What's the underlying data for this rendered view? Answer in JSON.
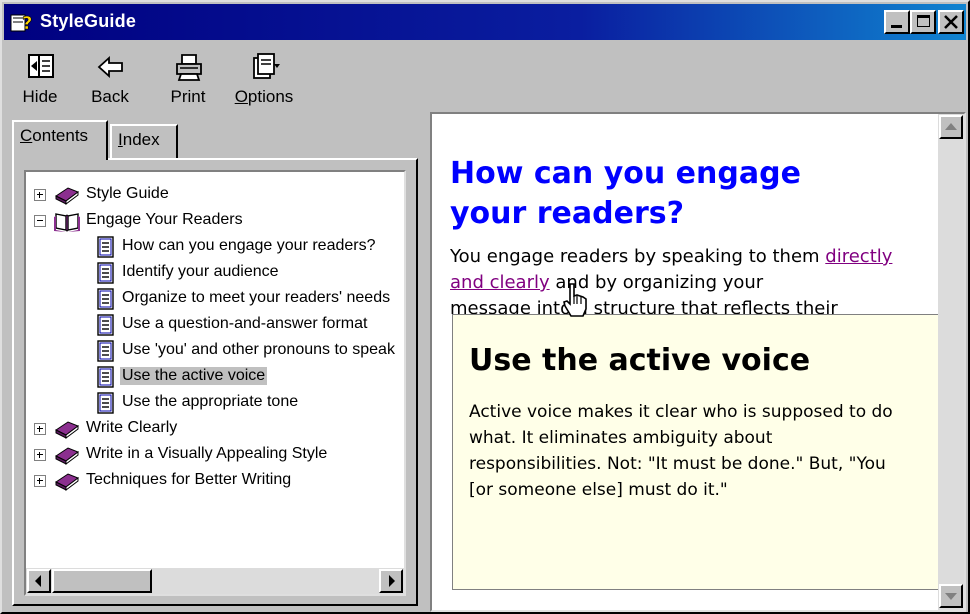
{
  "window": {
    "title": "StyleGuide"
  },
  "toolbar": {
    "hide": {
      "label": "Hide",
      "icon": "hide-icon"
    },
    "back": {
      "label": "Back",
      "icon": "back-arrow-icon"
    },
    "print": {
      "label": "Print",
      "icon": "printer-icon"
    },
    "options": {
      "label_first": "O",
      "label_rest": "ptions",
      "icon": "options-icon"
    }
  },
  "tabs": {
    "contents": {
      "first": "C",
      "rest": "ontents"
    },
    "index": {
      "first": "I",
      "rest": "ndex"
    }
  },
  "tree": [
    {
      "label": "Style Guide",
      "type": "book",
      "expanded": false
    },
    {
      "label": "Engage Your Readers",
      "type": "book-open",
      "expanded": true
    },
    {
      "label": "How can you engage your readers?",
      "type": "page"
    },
    {
      "label": "Identify your audience",
      "type": "page"
    },
    {
      "label": "Organize to meet your readers' needs",
      "type": "page"
    },
    {
      "label": "Use a question-and-answer format",
      "type": "page"
    },
    {
      "label": "Use 'you' and other pronouns to speak",
      "type": "page"
    },
    {
      "label": "Use the active voice",
      "type": "page",
      "selected": true
    },
    {
      "label": "Use the appropriate tone",
      "type": "page"
    },
    {
      "label": "Write Clearly",
      "type": "book",
      "expanded": false
    },
    {
      "label": "Write in a Visually Appealing Style",
      "type": "book",
      "expanded": false
    },
    {
      "label": "Techniques for Better Writing",
      "type": "book",
      "expanded": false
    }
  ],
  "article": {
    "heading_line1": "How can you engage",
    "heading_line2": "your readers?",
    "body_start": "You engage readers by speaking to them ",
    "link": "directly and clearly",
    "body_end": " and by organizing your",
    "body_line3": "message into a structure that reflects their"
  },
  "popup": {
    "title": "Use the active voice",
    "text": "Active voice makes it clear who is supposed to do what. It eliminates ambiguity about responsibilities. Not: \"It must be done.\" But, \"You [or someone else] must do it.\""
  },
  "colors": {
    "heading": "#0000ff",
    "link_visited": "#800080",
    "popup_bg": "#ffffe8",
    "titlebar": "#000080"
  }
}
